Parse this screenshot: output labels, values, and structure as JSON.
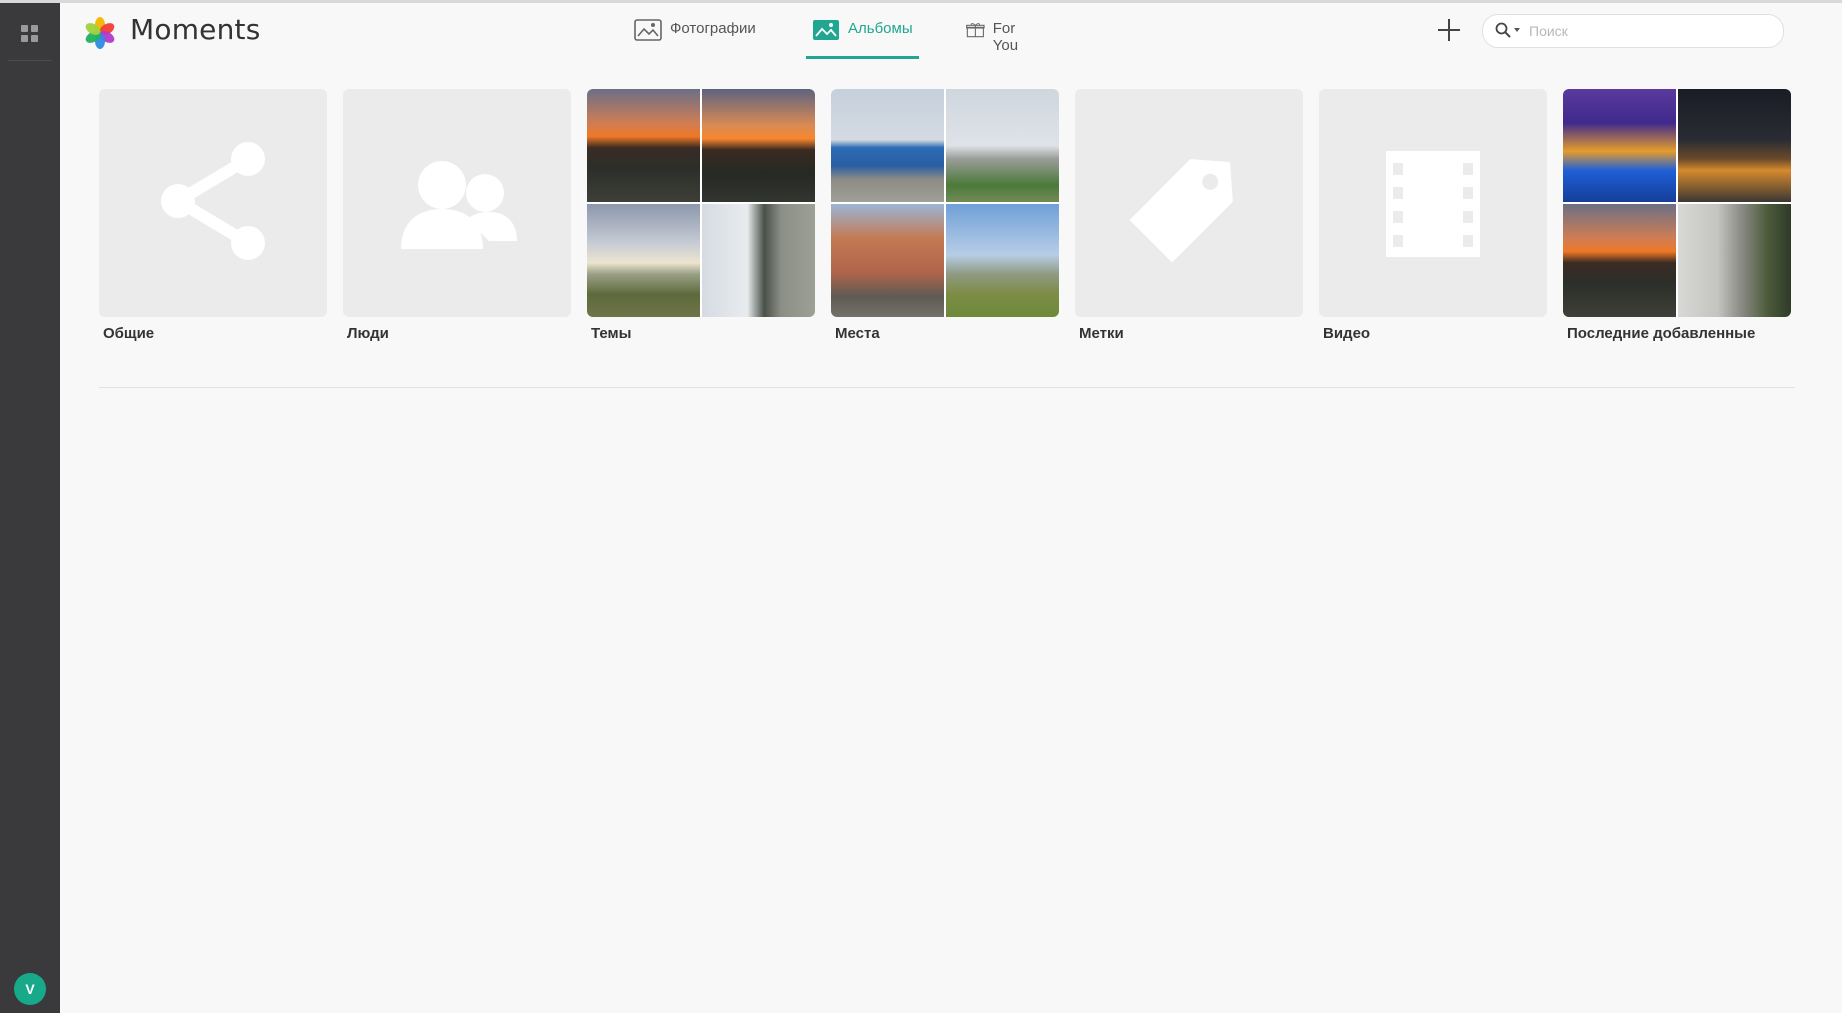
{
  "app": {
    "title": "Moments",
    "avatar_initial": "V"
  },
  "tabs": [
    {
      "label": "Фотографии",
      "icon": "image-icon",
      "active": false
    },
    {
      "label": "Альбомы",
      "icon": "album-icon",
      "active": true
    },
    {
      "label": "For You",
      "icon": "gift-icon",
      "active": false
    }
  ],
  "search": {
    "placeholder": "Поиск",
    "value": ""
  },
  "albums": [
    {
      "label": "Общие",
      "icon": "share-icon"
    },
    {
      "label": "Люди",
      "icon": "people-icon"
    },
    {
      "label": "Темы"
    },
    {
      "label": "Места"
    },
    {
      "label": "Метки",
      "icon": "tag-icon"
    },
    {
      "label": "Видео",
      "icon": "film-icon"
    },
    {
      "label": "Последние добавленные"
    }
  ],
  "colors": {
    "accent": "#21a691",
    "rail": "#3a3a3c",
    "background": "#f8f8f8"
  }
}
